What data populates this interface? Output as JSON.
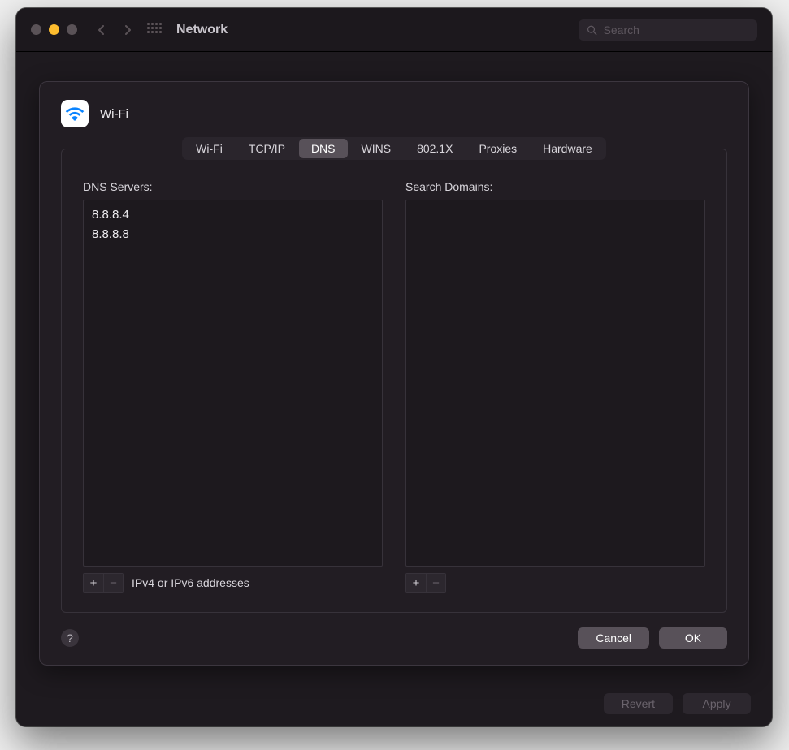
{
  "window": {
    "title": "Network"
  },
  "search": {
    "placeholder": "Search"
  },
  "service": {
    "name": "Wi-Fi"
  },
  "tabs": [
    {
      "label": "Wi-Fi",
      "active": false
    },
    {
      "label": "TCP/IP",
      "active": false
    },
    {
      "label": "DNS",
      "active": true
    },
    {
      "label": "WINS",
      "active": false
    },
    {
      "label": "802.1X",
      "active": false
    },
    {
      "label": "Proxies",
      "active": false
    },
    {
      "label": "Hardware",
      "active": false
    }
  ],
  "dns": {
    "servers_label": "DNS Servers:",
    "servers": [
      "8.8.8.4",
      "8.8.8.8"
    ],
    "hint": "IPv4 or IPv6 addresses",
    "domains_label": "Search Domains:",
    "domains": []
  },
  "buttons": {
    "cancel": "Cancel",
    "ok": "OK",
    "revert": "Revert",
    "apply": "Apply",
    "help": "?"
  }
}
